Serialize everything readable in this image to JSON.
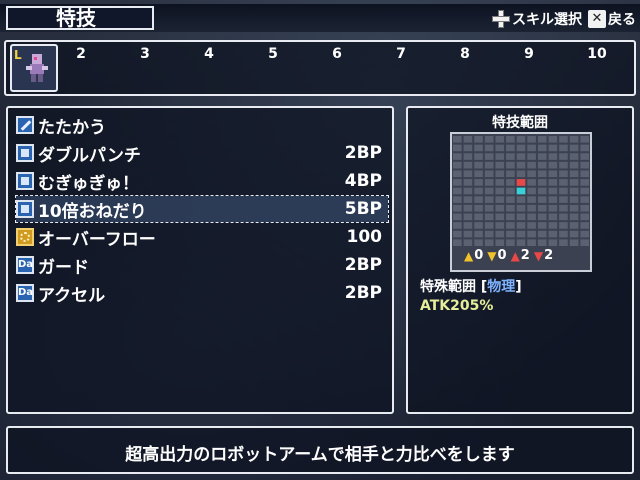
{
  "header": {
    "title": "特技",
    "hint_skill_select": "スキル選択",
    "hint_back": "戻る"
  },
  "levels": {
    "current_badge": "L",
    "numbers": [
      "2",
      "3",
      "4",
      "5",
      "6",
      "7",
      "8",
      "9",
      "10"
    ]
  },
  "skills": [
    {
      "icon": "sword-icon",
      "name": "たたかう",
      "cost": ""
    },
    {
      "icon": "square-skill-icon",
      "name": "ダブルパンチ",
      "cost": "2BP"
    },
    {
      "icon": "square-skill-icon",
      "name": "むぎゅぎゅ！",
      "cost": "4BP"
    },
    {
      "icon": "square-skill-icon",
      "name": "10倍おねだり",
      "cost": "5BP",
      "selected": true
    },
    {
      "icon": "overflow-icon",
      "name": "オーバーフロー",
      "cost": "100"
    },
    {
      "icon": "da-icon",
      "name": "ガード",
      "cost": "2BP"
    },
    {
      "icon": "da-icon",
      "name": "アクセル",
      "cost": "2BP"
    }
  ],
  "range_panel": {
    "title": "特技範囲",
    "stats": [
      {
        "arrow": "up",
        "color": "#f2c22a",
        "value": "0"
      },
      {
        "arrow": "down",
        "color": "#f2c22a",
        "value": "0"
      },
      {
        "arrow": "up",
        "color": "#e84848",
        "value": "2"
      },
      {
        "arrow": "down",
        "color": "#e84848",
        "value": "2"
      }
    ],
    "range_label": "特殊範囲",
    "range_type": "物理",
    "atk": "ATK205%",
    "grid_cols": 13,
    "grid_rows": 13,
    "markers": [
      {
        "col": 6,
        "row": 5,
        "color": "#e84848"
      },
      {
        "col": 6,
        "row": 6,
        "color": "#3ad0d8"
      }
    ]
  },
  "description": "超高出力のロボットアームで相手と力比べをします"
}
